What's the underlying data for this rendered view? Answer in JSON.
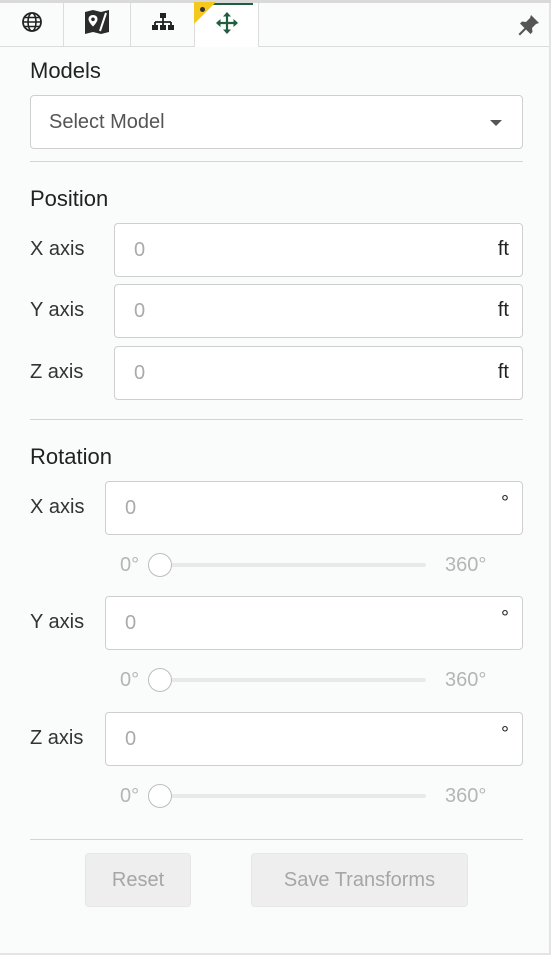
{
  "tabs": [
    {
      "icon": "globe-icon"
    },
    {
      "icon": "map-marker-icon"
    },
    {
      "icon": "hierarchy-icon"
    },
    {
      "icon": "move-icon",
      "active": true
    }
  ],
  "models": {
    "title": "Models",
    "select_value": "Select Model"
  },
  "position": {
    "title": "Position",
    "unit": "ft",
    "axes": [
      {
        "label": "X axis",
        "placeholder": "0"
      },
      {
        "label": "Y axis",
        "placeholder": "0"
      },
      {
        "label": "Z axis",
        "placeholder": "0"
      }
    ]
  },
  "rotation": {
    "title": "Rotation",
    "unit": "°",
    "slider_min": "0°",
    "slider_max": "360°",
    "axes": [
      {
        "label": "X axis",
        "placeholder": "0",
        "slider_value": 0
      },
      {
        "label": "Y axis",
        "placeholder": "0",
        "slider_value": 0
      },
      {
        "label": "Z axis",
        "placeholder": "0",
        "slider_value": 0
      }
    ]
  },
  "buttons": {
    "reset": "Reset",
    "save": "Save Transforms"
  },
  "colors": {
    "active_tab_accent": "#1f5f3f",
    "badge": "#f5c81e"
  }
}
